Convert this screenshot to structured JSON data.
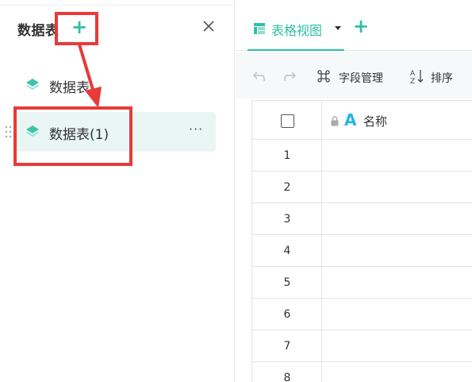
{
  "sidebar": {
    "title": "数据表",
    "add_icon": "plus-icon",
    "close_icon": "close-icon",
    "items": [
      {
        "label": "数据表",
        "icon": "layers-icon",
        "active": false
      },
      {
        "label": "数据表(1)",
        "icon": "layers-icon",
        "active": true,
        "more": "···"
      }
    ]
  },
  "view_tabs": {
    "active_label": "表格视图",
    "add_icon": "plus-icon"
  },
  "toolbar": {
    "field_manage_label": "字段管理",
    "sort_label": "排序"
  },
  "grid": {
    "primary_field": {
      "name": "名称",
      "type_glyph": "A"
    },
    "rows": [
      {
        "num": "1"
      },
      {
        "num": "2"
      },
      {
        "num": "3"
      },
      {
        "num": "4"
      },
      {
        "num": "5"
      },
      {
        "num": "6"
      },
      {
        "num": "7"
      },
      {
        "num": "8"
      }
    ]
  },
  "colors": {
    "accent": "#2fbfa8",
    "annotation": "#e83a3a",
    "active_bg": "#e9f6f4"
  }
}
